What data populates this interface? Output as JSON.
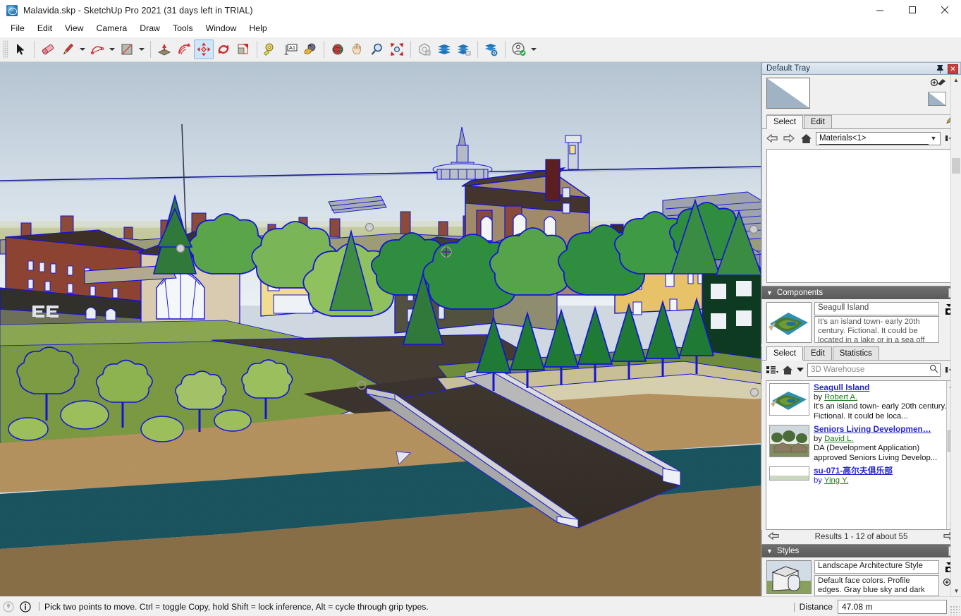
{
  "window": {
    "title": "Malavida.skp - SketchUp Pro 2021 (31 days left in TRIAL)",
    "app_icon": "sketchup-icon",
    "minimize": "–",
    "maximize": "□",
    "close": "✕"
  },
  "menu": {
    "items": [
      {
        "label": "File"
      },
      {
        "label": "Edit"
      },
      {
        "label": "View"
      },
      {
        "label": "Camera"
      },
      {
        "label": "Draw"
      },
      {
        "label": "Tools"
      },
      {
        "label": "Window"
      },
      {
        "label": "Help"
      }
    ]
  },
  "toolbar": {
    "groups": [
      {
        "tools": [
          {
            "name": "select-tool",
            "icon": "arrow-cursor-icon",
            "active": false
          }
        ]
      },
      {
        "tools": [
          {
            "name": "eraser-tool",
            "icon": "eraser-icon",
            "active": false
          },
          {
            "name": "line-tool",
            "icon": "pencil-icon",
            "active": false,
            "dropdown": true
          },
          {
            "name": "arc-tool",
            "icon": "arc-icon",
            "active": false,
            "dropdown": true
          },
          {
            "name": "rectangle-tool",
            "icon": "rectangle-icon",
            "active": false,
            "dropdown": true
          }
        ]
      },
      {
        "tools": [
          {
            "name": "pushpull-tool",
            "icon": "push-pull-icon",
            "active": false
          },
          {
            "name": "followme-tool",
            "icon": "follow-me-icon",
            "active": false
          },
          {
            "name": "move-tool",
            "icon": "move-arrows-icon",
            "active": true
          },
          {
            "name": "rotate-tool",
            "icon": "rotate-icon",
            "active": false
          },
          {
            "name": "scale-tool",
            "icon": "scale-icon",
            "active": false
          }
        ]
      },
      {
        "tools": [
          {
            "name": "tape-measure-tool",
            "icon": "tape-measure-icon",
            "active": false
          },
          {
            "name": "text-tool",
            "icon": "text-a1-icon",
            "active": false
          },
          {
            "name": "paint-bucket-tool",
            "icon": "paint-bucket-icon",
            "active": false
          }
        ]
      },
      {
        "tools": [
          {
            "name": "orbit-tool",
            "icon": "orbit-icon",
            "active": false
          },
          {
            "name": "pan-tool",
            "icon": "hand-icon",
            "active": false
          },
          {
            "name": "zoom-tool",
            "icon": "magnifier-icon",
            "active": false
          },
          {
            "name": "zoom-extents-tool",
            "icon": "zoom-extents-icon",
            "active": false
          }
        ]
      },
      {
        "tools": [
          {
            "name": "section-plane-tool",
            "icon": "section-plane-icon",
            "active": false
          },
          {
            "name": "model-info-tool",
            "icon": "layers-blue-icon",
            "active": false
          },
          {
            "name": "layers-tool",
            "icon": "stack-layers-icon",
            "active": false
          }
        ]
      },
      {
        "tools": [
          {
            "name": "manage-layers-tool",
            "icon": "layers-gear-icon",
            "active": false
          }
        ]
      },
      {
        "tools": [
          {
            "name": "account-button",
            "icon": "user-check-icon",
            "active": false,
            "dropdown": true
          }
        ]
      }
    ]
  },
  "tray": {
    "title": "Default Tray",
    "pin_icon": "pin-icon",
    "close_icon": "close-icon",
    "materials": {
      "panel_name": "Materials",
      "swatch_color": "#9fb3c4",
      "tabs": [
        {
          "label": "Select",
          "selected": true
        },
        {
          "label": "Edit",
          "selected": false
        }
      ],
      "back_icon": "arrow-left-icon",
      "forward_icon": "arrow-right-icon",
      "home_icon": "home-icon",
      "collection": "Materials<1>",
      "details_icon": "details-arrow-icon",
      "eyedropper_icon": "eyedropper-icon",
      "create_material_icon": "create-material-icon"
    },
    "components": {
      "panel_name": "Components",
      "collapse_icon": "triangle-down-icon",
      "close_icon": "close-icon",
      "selected": {
        "name": "Seagull Island",
        "description": "It's an island town- early 20th century. Fictional. It could be located in a lake or in a sea off the shores of Massachusetts...",
        "thumbnail": "seagull-island-thumb"
      },
      "tabs": [
        {
          "label": "Select",
          "selected": true
        },
        {
          "label": "Edit",
          "selected": false
        },
        {
          "label": "Statistics",
          "selected": false
        }
      ],
      "view_options_icon": "view-options-icon",
      "home_icon": "home-icon",
      "dropdown_icon": "chevron-down-icon",
      "search_value": "3D Warehouse",
      "search_icon": "search-icon",
      "details_icon": "details-arrow-icon",
      "results": [
        {
          "title": "Seagull Island",
          "by_prefix": "by ",
          "author": "Robert A.",
          "description": "It's an island town- early 20th century. Fictional. It could be loca...",
          "thumbnail": "seagull-island-thumb"
        },
        {
          "title": "Seniors Living Developmen…",
          "by_prefix": "by ",
          "author": "David L.",
          "description": "DA (Development Application) approved Seniors Living Develop...",
          "thumbnail": "seniors-living-thumb"
        },
        {
          "title": "su-071-高尔夫俱乐部",
          "by_prefix": "by ",
          "author": "Ying Y.",
          "description": "",
          "thumbnail": "su071-thumb"
        }
      ],
      "pager": {
        "prev_icon": "arrow-left-icon",
        "text": "Results 1 - 12 of about 55",
        "next_icon": "arrow-right-icon"
      }
    },
    "styles": {
      "panel_name": "Styles",
      "collapse_icon": "triangle-down-icon",
      "close_icon": "close-icon",
      "name": "Landscape Architecture Style",
      "description": "Default face colors. Profile edges. Gray blue sky and dark green background.",
      "thumbnail": "style-preview-thumb",
      "create_icon": "create-style-icon",
      "update_icon": "update-style-icon"
    }
  },
  "statusbar": {
    "geo_icon": "geo-location-icon",
    "info_icon": "info-icon",
    "message": "Pick two points to move.  Ctrl = toggle Copy, hold Shift = lock inference, Alt = cycle through grip types.",
    "vcb_label": "Distance",
    "vcb_value": "47.08 m"
  },
  "viewport": {
    "name": "sketchup-3d-viewport",
    "model": "Malavida island town model",
    "colors": {
      "sky_top": "#b9c7d4",
      "sky_bottom": "#e8eef3",
      "ground_horizon": "#c9cda0",
      "water": "#1a5560",
      "sand": "#8a7048",
      "sand_light": "#b79360",
      "grass": "#7d9b43",
      "road": "#3a332e",
      "profile_edge": "#1414d8",
      "bridge_deck": "#3a322c",
      "bridge_rail": "#9a9a9a"
    }
  }
}
